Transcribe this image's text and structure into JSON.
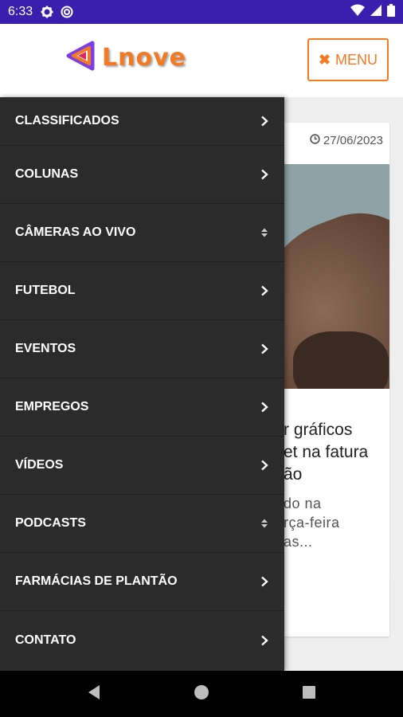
{
  "status_bar": {
    "time": "6:33",
    "icons": [
      "gear-icon",
      "sync-icon",
      "wifi-icon",
      "signal-icon",
      "battery-icon"
    ]
  },
  "header": {
    "logo_text": "Lnove",
    "menu_label": "MENU",
    "menu_icon": "close-icon",
    "accent_color": "#f47920"
  },
  "article": {
    "date": "27/06/2023",
    "title": "r gráficos\net na fatura\não",
    "excerpt": "do na\nrça-feira\nas..."
  },
  "drawer": {
    "items": [
      {
        "label": "CLASSIFICADOS",
        "icon": "chevron-right-icon"
      },
      {
        "label": "COLUNAS",
        "icon": "chevron-right-icon"
      },
      {
        "label": "CÂMERAS AO VIVO",
        "icon": "sort-icon"
      },
      {
        "label": "FUTEBOL",
        "icon": "chevron-right-icon"
      },
      {
        "label": "EVENTOS",
        "icon": "chevron-right-icon"
      },
      {
        "label": "EMPREGOS",
        "icon": "chevron-right-icon"
      },
      {
        "label": "VÍDEOS",
        "icon": "chevron-right-icon"
      },
      {
        "label": "PODCASTS",
        "icon": "sort-icon"
      },
      {
        "label": "FARMÁCIAS DE PLANTÃO",
        "icon": "chevron-right-icon"
      },
      {
        "label": "CONTATO",
        "icon": "chevron-right-icon"
      }
    ]
  },
  "nav_bar": {
    "icons": [
      "back-icon",
      "home-icon",
      "recents-icon"
    ]
  }
}
